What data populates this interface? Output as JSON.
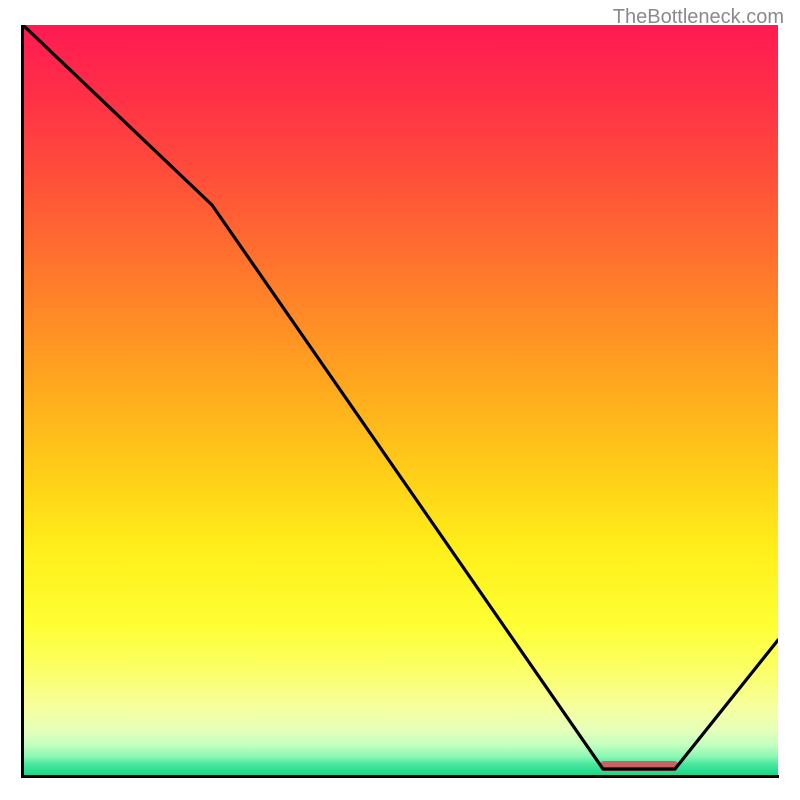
{
  "watermark": "TheBottleneck.com",
  "chart_data": {
    "type": "line",
    "title": "",
    "xlabel": "",
    "ylabel": "",
    "xlim": [
      0,
      100
    ],
    "ylim": [
      0,
      100
    ],
    "x": [
      0,
      25,
      77,
      86,
      100
    ],
    "y": [
      100,
      76,
      0,
      0,
      18
    ],
    "gradient_bands": [
      {
        "pos": 0.0,
        "color": "#ff1a52"
      },
      {
        "pos": 0.1,
        "color": "#ff3146"
      },
      {
        "pos": 0.2,
        "color": "#ff4e3a"
      },
      {
        "pos": 0.3,
        "color": "#ff6e2f"
      },
      {
        "pos": 0.4,
        "color": "#ff8e25"
      },
      {
        "pos": 0.5,
        "color": "#ffae1d"
      },
      {
        "pos": 0.6,
        "color": "#ffcf18"
      },
      {
        "pos": 0.7,
        "color": "#ffef1a"
      },
      {
        "pos": 0.8,
        "color": "#feff33"
      },
      {
        "pos": 0.86,
        "color": "#fcff66"
      },
      {
        "pos": 0.91,
        "color": "#f6ff9e"
      },
      {
        "pos": 0.94,
        "color": "#e6ffba"
      },
      {
        "pos": 0.96,
        "color": "#c3ffbf"
      },
      {
        "pos": 0.975,
        "color": "#8cf8b3"
      },
      {
        "pos": 0.985,
        "color": "#4de8a0"
      },
      {
        "pos": 1.0,
        "color": "#17d989"
      }
    ],
    "marker": {
      "x_center": 81.5,
      "width": 10,
      "color": "#c86262"
    },
    "line_color": "#000000"
  }
}
